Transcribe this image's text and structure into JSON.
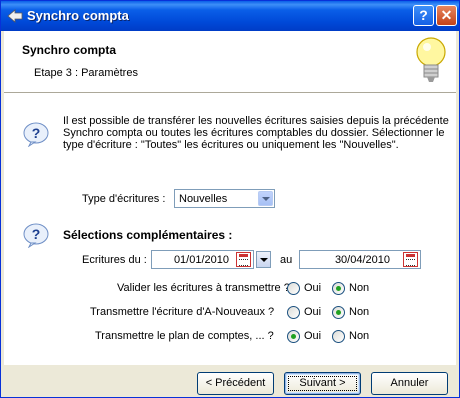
{
  "window": {
    "title": "Synchro compta"
  },
  "header": {
    "title": "Synchro compta",
    "step": "Etape 3 : Paramètres"
  },
  "intro": {
    "text": "Il est possible de transférer les nouvelles écritures saisies depuis la précédente Synchro compta ou toutes les écritures comptables du dossier. Sélectionner le type d'écriture : \"Toutes\" les écritures ou uniquement les \"Nouvelles\"."
  },
  "type_ecritures": {
    "label": "Type d'écritures :",
    "value": "Nouvelles"
  },
  "selections": {
    "title": "Sélections complémentaires :",
    "ecritures_du_label": "Ecritures du :",
    "date_from": "01/01/2010",
    "au_label": "au",
    "date_to": "30/04/2010"
  },
  "options": [
    {
      "label": "Valider les écritures à transmettre ?",
      "oui": "Oui",
      "non": "Non",
      "selected": "Non"
    },
    {
      "label": "Transmettre l'écriture d'A-Nouveaux ?",
      "oui": "Oui",
      "non": "Non",
      "selected": "Non"
    },
    {
      "label": "Transmettre le plan de comptes, ... ?",
      "oui": "Oui",
      "non": "Non",
      "selected": "Oui"
    }
  ],
  "buttons": {
    "previous": "< Précédent",
    "next": "Suivant >",
    "cancel": "Annuler"
  },
  "icons": {
    "title": "app-arrow-icon",
    "help": "help-icon",
    "close": "close-icon",
    "bulb": "lightbulb-icon",
    "question": "question-icon",
    "calendar": "calendar-icon"
  },
  "colors": {
    "titlebar": "#0a5fe8",
    "dialog_bg": "#ece9d8",
    "radio_selected": "#21a121"
  }
}
